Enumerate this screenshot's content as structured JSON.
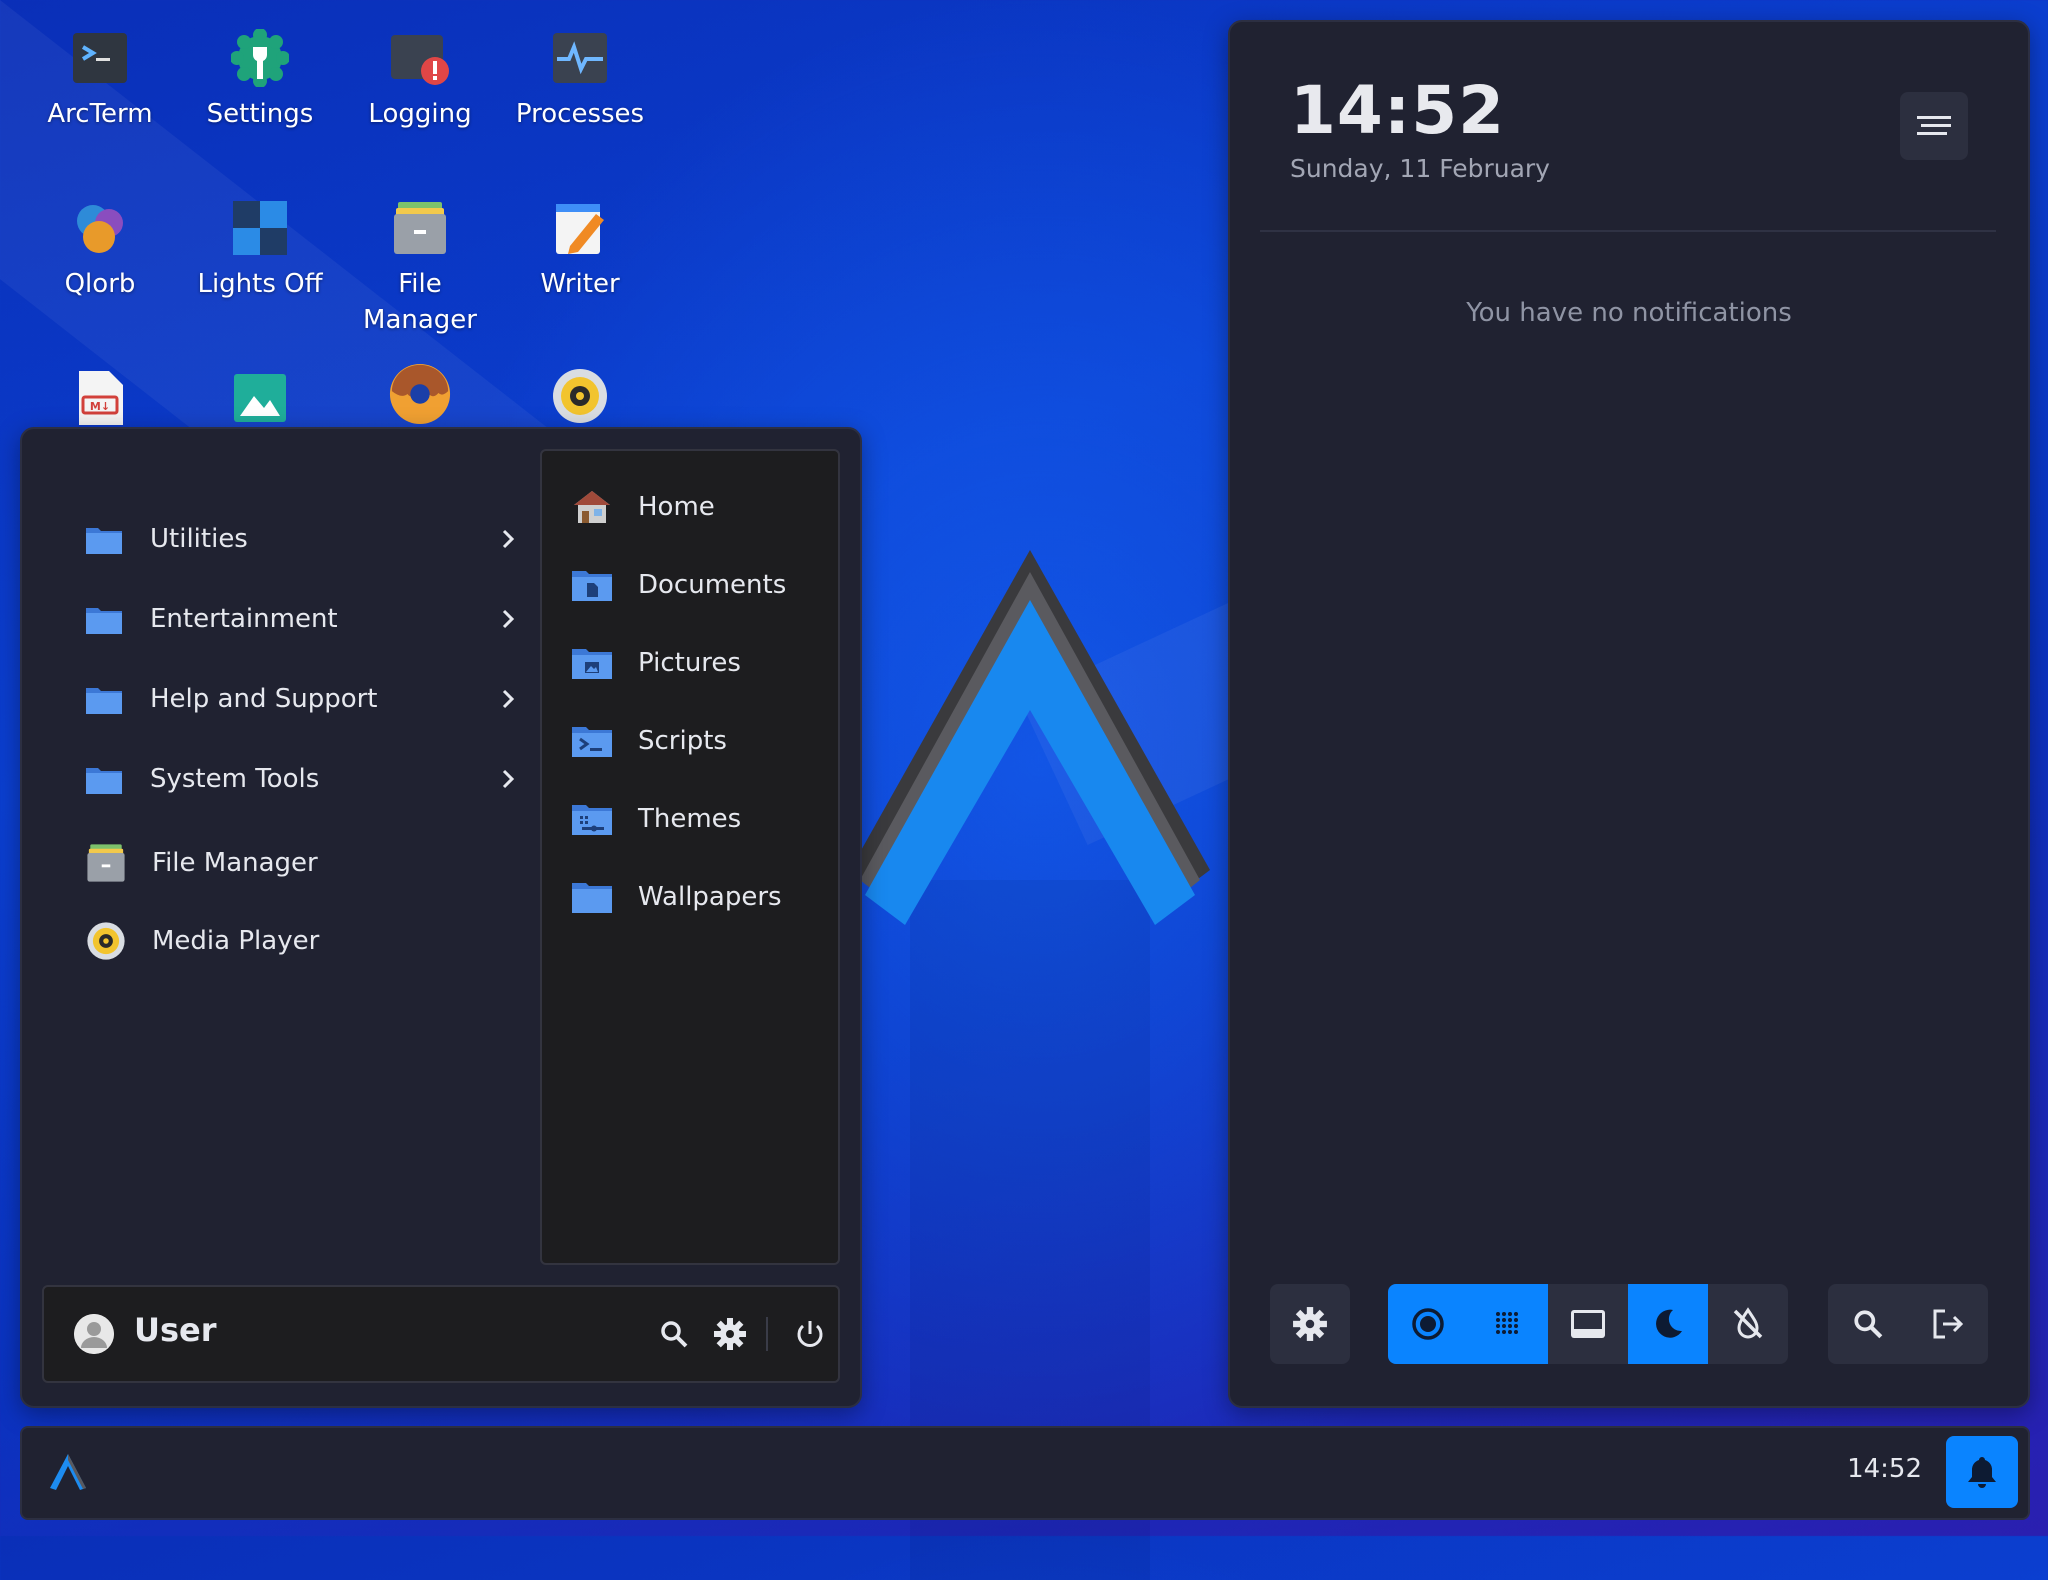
{
  "desktop": {
    "icons": [
      {
        "label": "ArcTerm",
        "icon": "terminal-icon"
      },
      {
        "label": "Settings",
        "icon": "settings-wrench-icon"
      },
      {
        "label": "Logging",
        "icon": "logging-alert-icon"
      },
      {
        "label": "Processes",
        "icon": "activity-monitor-icon"
      },
      {
        "label": "Qlorb",
        "icon": "qlorb-game-icon"
      },
      {
        "label": "Lights Off",
        "icon": "lights-off-icon"
      },
      {
        "label": "File Manager",
        "icon": "file-cabinet-icon"
      },
      {
        "label": "Writer",
        "icon": "text-editor-icon"
      },
      {
        "label": "",
        "icon": "markdown-file-icon"
      },
      {
        "label": "",
        "icon": "image-viewer-icon"
      },
      {
        "label": "",
        "icon": "donut-icon"
      },
      {
        "label": "",
        "icon": "media-player-icon"
      }
    ]
  },
  "app_menu": {
    "categories": [
      {
        "label": "Utilities"
      },
      {
        "label": "Entertainment"
      },
      {
        "label": "Help and Support"
      },
      {
        "label": "System Tools"
      }
    ],
    "apps": [
      {
        "label": "File Manager"
      },
      {
        "label": "Media Player"
      }
    ],
    "places": [
      {
        "label": "Home",
        "icon": "home-folder-icon"
      },
      {
        "label": "Documents",
        "icon": "documents-folder-icon"
      },
      {
        "label": "Pictures",
        "icon": "pictures-folder-icon"
      },
      {
        "label": "Scripts",
        "icon": "scripts-folder-icon"
      },
      {
        "label": "Themes",
        "icon": "themes-folder-icon"
      },
      {
        "label": "Wallpapers",
        "icon": "wallpapers-folder-icon"
      }
    ],
    "user": {
      "name": "User"
    }
  },
  "notifications": {
    "time": "14:52",
    "date": "Sunday, 11 February",
    "empty_message": "You have no notifications",
    "quick_settings": [
      {
        "name": "settings",
        "icon": "gear-icon",
        "active": false
      },
      {
        "name": "record",
        "icon": "record-icon",
        "active": true
      },
      {
        "name": "grain",
        "icon": "dots-grid-icon",
        "active": true
      },
      {
        "name": "panel",
        "icon": "panel-icon",
        "active": false
      },
      {
        "name": "night-light",
        "icon": "moon-icon",
        "active": true
      },
      {
        "name": "notifications-off",
        "icon": "no-drop-icon",
        "active": false
      },
      {
        "name": "search",
        "icon": "search-icon",
        "active": false
      },
      {
        "name": "logout",
        "icon": "logout-icon",
        "active": false
      }
    ]
  },
  "taskbar": {
    "time": "14:52"
  },
  "colors": {
    "accent": "#0a84ff",
    "panel_bg": "#202231",
    "inner_bg": "#1d1d1f",
    "folder_blue": "#4f8fe6"
  }
}
